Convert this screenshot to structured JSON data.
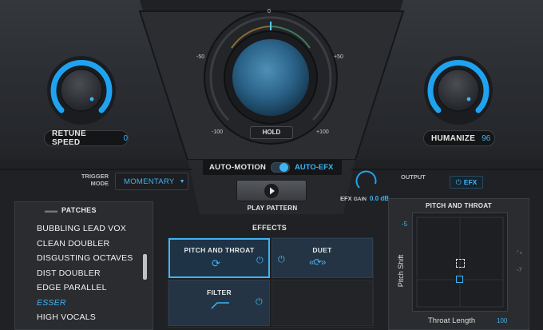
{
  "retune": {
    "label": "RETUNE SPEED",
    "value": "0"
  },
  "humanize": {
    "label": "HUMANIZE",
    "value": "96"
  },
  "dial": {
    "tick_top": "0",
    "tick_left": "-50",
    "tick_right": "+50",
    "tick_bl": "-100",
    "tick_br": "+100",
    "hold_label": "HOLD"
  },
  "auto": {
    "motion_label": "AUTO-MOTION",
    "efx_label": "AUTO-EFX",
    "toggle_on": true
  },
  "trigger": {
    "label_line1": "TRIGGER",
    "label_line2": "MODE",
    "value": "MOMENTARY"
  },
  "play": {
    "label": "PLAY PATTERN"
  },
  "output": {
    "label": "OUTPUT",
    "efx_button": "EFX"
  },
  "efx_gain": {
    "label1": "EFX",
    "label2": "GAIN",
    "value": "0.0 dB"
  },
  "patches": {
    "header": "PATCHES",
    "items": [
      "BUBBLING LEAD VOX",
      "CLEAN DOUBLER",
      "DISGUSTING OCTAVES",
      "DIST DOUBLER",
      "EDGE PARALLEL",
      "ESSER",
      "HIGH VOCALS"
    ],
    "selected_index": 5
  },
  "effects": {
    "header": "EFFECTS",
    "pitch_throat": "PITCH AND THROAT",
    "duet": "DUET",
    "filter": "FILTER"
  },
  "xy": {
    "title": "PITCH AND THROAT",
    "y_label": "Pitch Shift",
    "x_label": "Throat Length",
    "y_value": "-5",
    "x_value": "100"
  },
  "colors": {
    "accent": "#3fb4f2",
    "bg": "#1b1d20"
  }
}
